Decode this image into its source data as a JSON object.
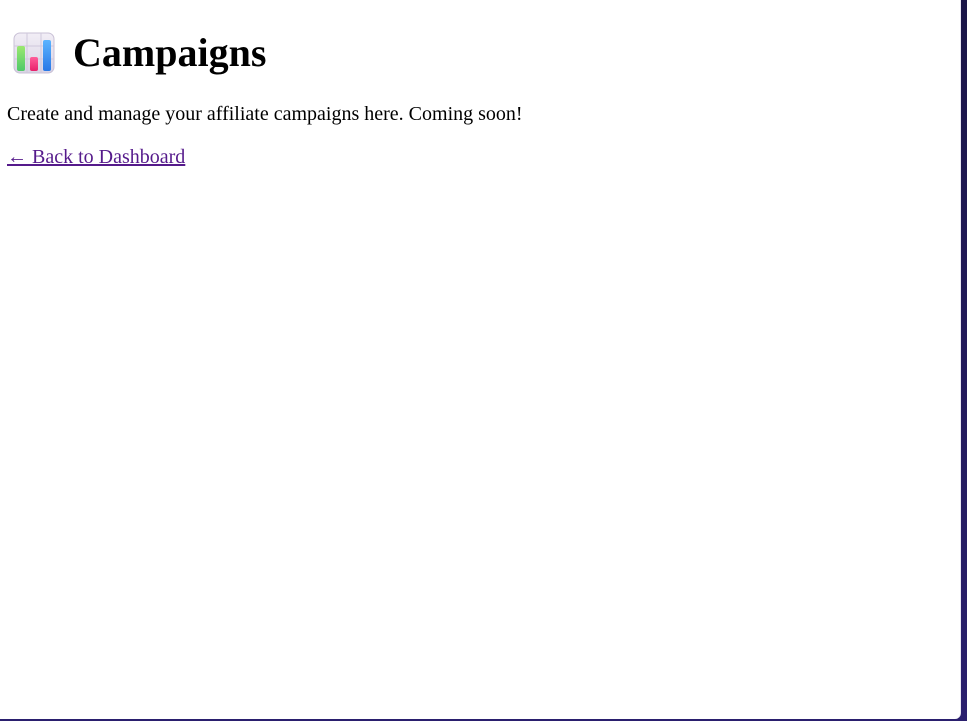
{
  "page": {
    "title": "Campaigns",
    "title_icon": "bar-chart-icon",
    "description": "Create and manage your affiliate campaigns here. Coming soon!",
    "back_link_label": "← Back to Dashboard"
  },
  "colors": {
    "link_visited": "#551a8b",
    "frame_background": "#1a1547",
    "text": "#000000"
  }
}
